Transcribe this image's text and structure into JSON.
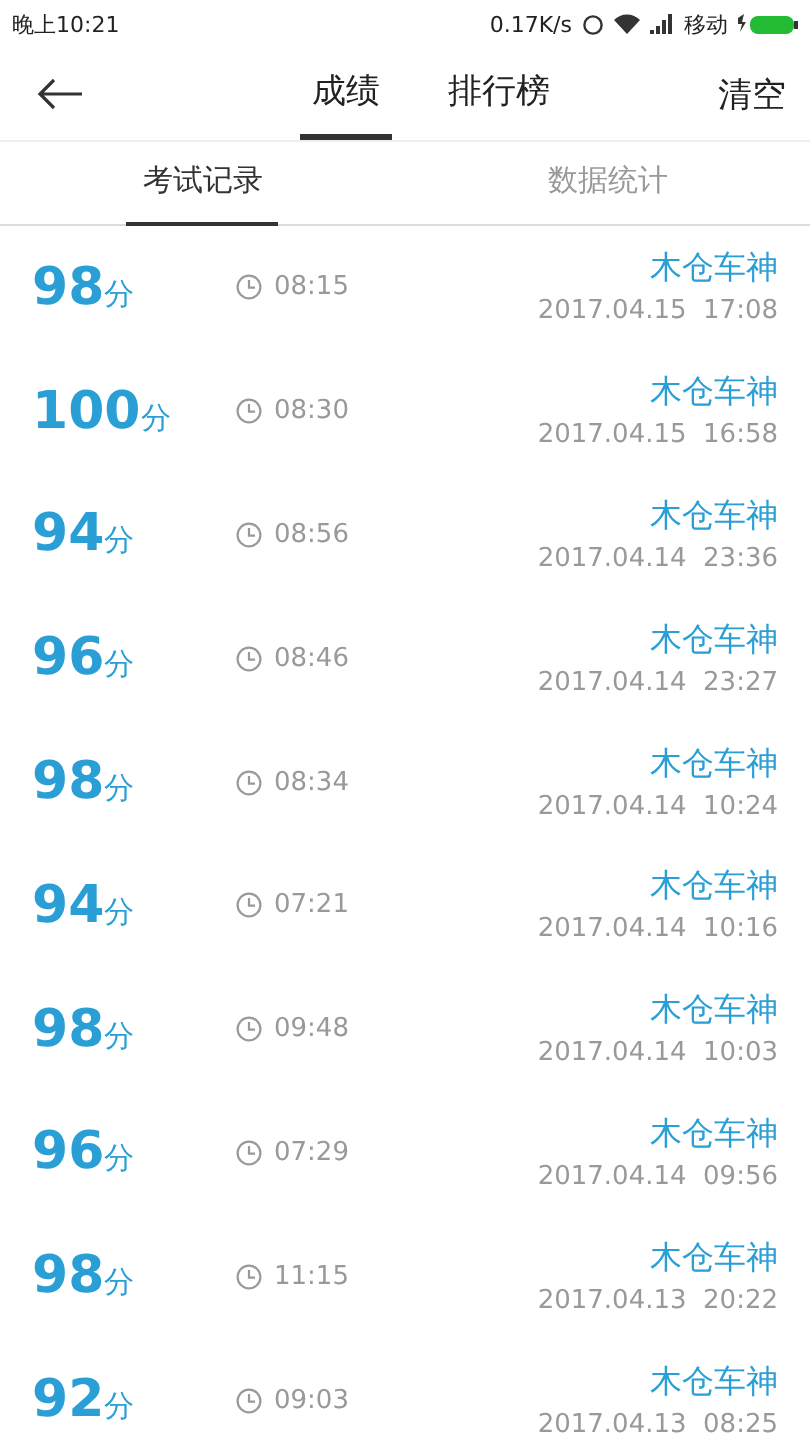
{
  "status_bar": {
    "time": "晚上10:21",
    "speed": "0.17K/s",
    "carrier": "移动"
  },
  "header": {
    "tabs": [
      {
        "label": "成绩",
        "selected": true
      },
      {
        "label": "排行榜",
        "selected": false
      }
    ],
    "action": "清空"
  },
  "sub_tabs": [
    {
      "label": "考试记录",
      "selected": true
    },
    {
      "label": "数据统计",
      "selected": false
    }
  ],
  "records": [
    {
      "score": "98",
      "unit": "分",
      "duration": "08:15",
      "name": "木仓车神",
      "date": "2017.04.15  17:08"
    },
    {
      "score": "100",
      "unit": "分",
      "duration": "08:30",
      "name": "木仓车神",
      "date": "2017.04.15  16:58"
    },
    {
      "score": "94",
      "unit": "分",
      "duration": "08:56",
      "name": "木仓车神",
      "date": "2017.04.14  23:36"
    },
    {
      "score": "96",
      "unit": "分",
      "duration": "08:46",
      "name": "木仓车神",
      "date": "2017.04.14  23:27"
    },
    {
      "score": "98",
      "unit": "分",
      "duration": "08:34",
      "name": "木仓车神",
      "date": "2017.04.14  10:24"
    },
    {
      "score": "94",
      "unit": "分",
      "duration": "07:21",
      "name": "木仓车神",
      "date": "2017.04.14  10:16"
    },
    {
      "score": "98",
      "unit": "分",
      "duration": "09:48",
      "name": "木仓车神",
      "date": "2017.04.14  10:03"
    },
    {
      "score": "96",
      "unit": "分",
      "duration": "07:29",
      "name": "木仓车神",
      "date": "2017.04.14  09:56"
    },
    {
      "score": "98",
      "unit": "分",
      "duration": "11:15",
      "name": "木仓车神",
      "date": "2017.04.13  20:22"
    },
    {
      "score": "92",
      "unit": "分",
      "duration": "09:03",
      "name": "木仓车神",
      "date": "2017.04.13  08:25"
    }
  ]
}
